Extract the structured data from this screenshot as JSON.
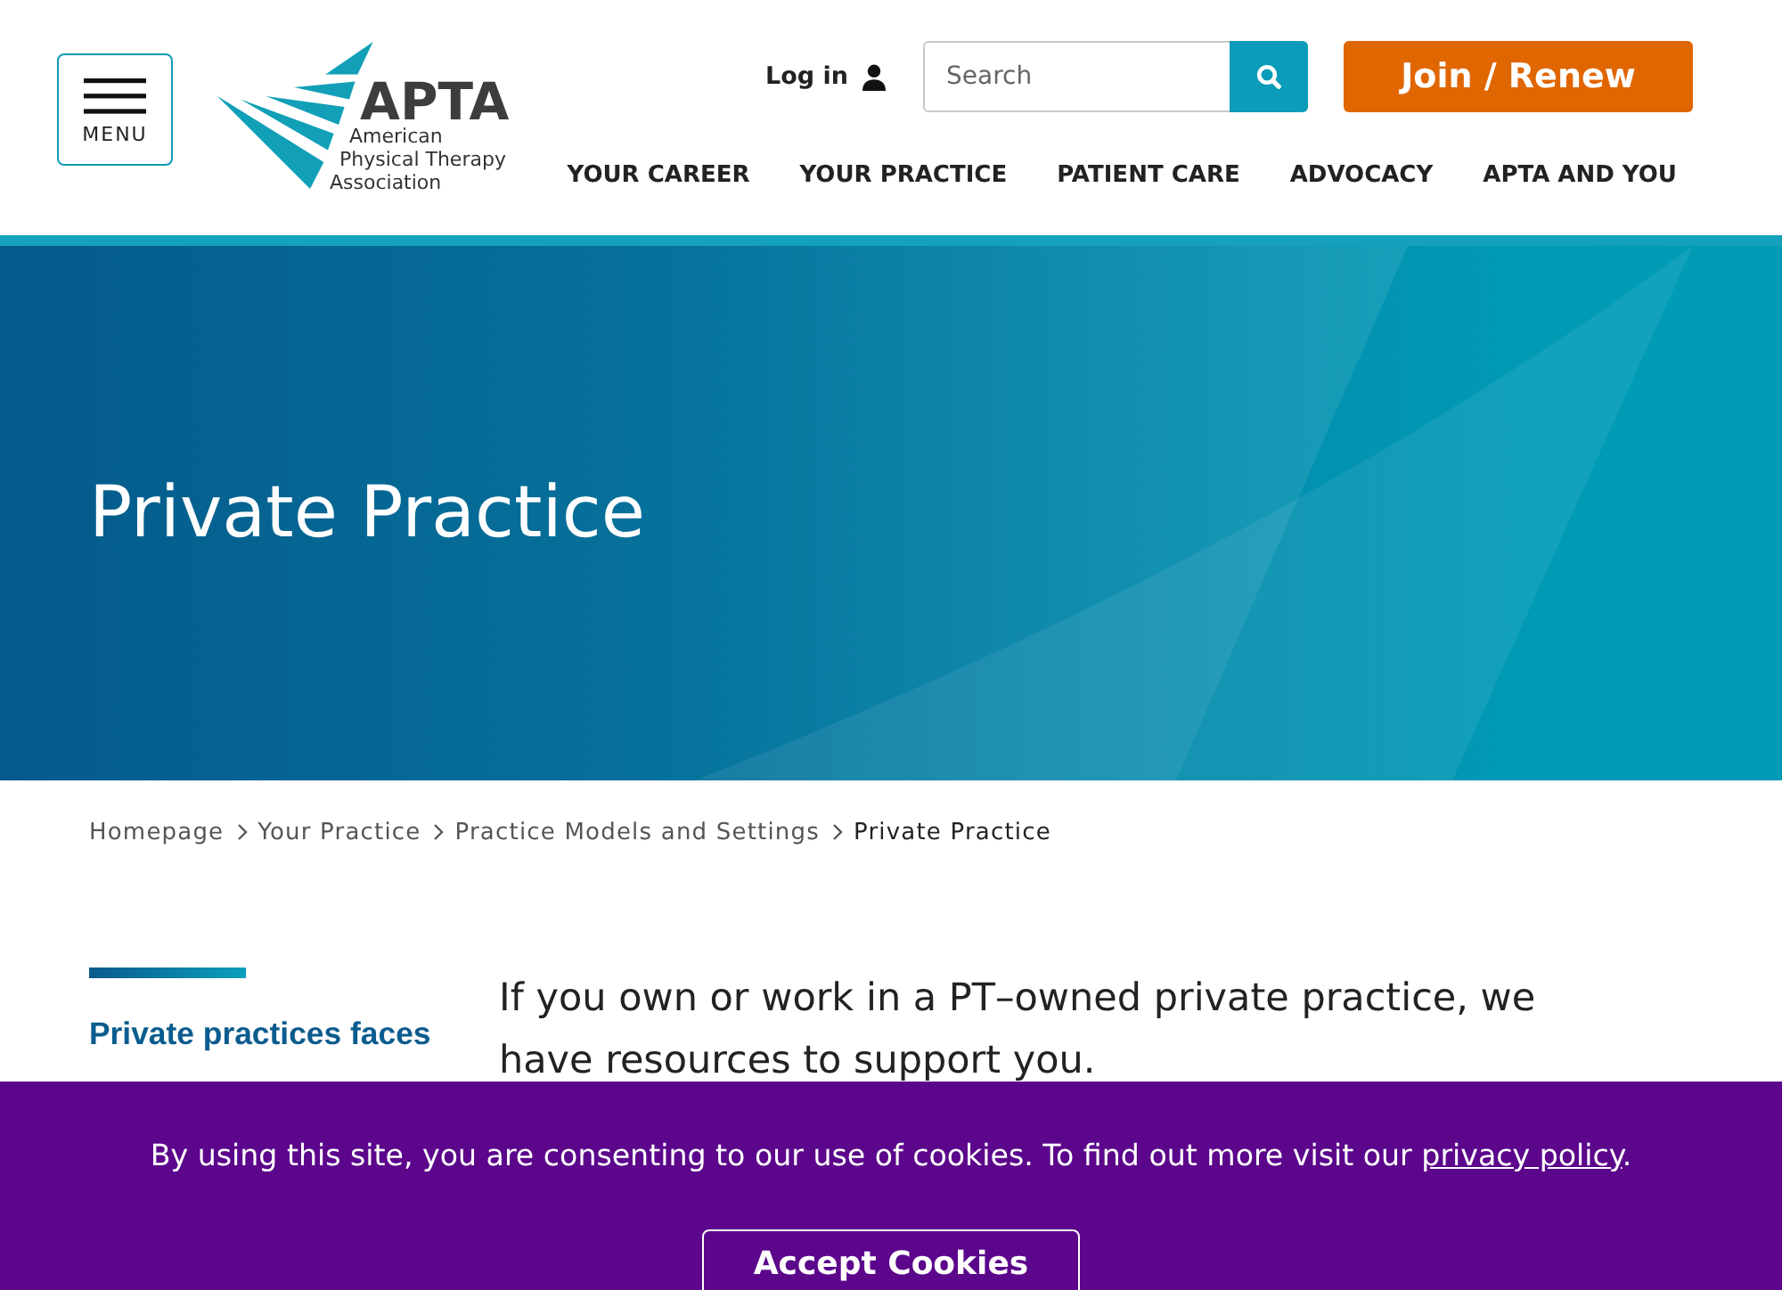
{
  "header": {
    "menu_button": {
      "label": "MENU"
    },
    "logo": {
      "wordmark": "APTA",
      "subtitle_lines": [
        "American",
        "Physical Therapy",
        "Association"
      ]
    },
    "login": {
      "label": "Log in"
    },
    "search": {
      "placeholder": "Search"
    },
    "join_button": {
      "label": "Join / Renew"
    },
    "nav": [
      "YOUR CAREER",
      "YOUR PRACTICE",
      "PATIENT CARE",
      "ADVOCACY",
      "APTA AND YOU"
    ]
  },
  "hero": {
    "title": "Private Practice"
  },
  "breadcrumb": [
    {
      "label": "Homepage",
      "current": false
    },
    {
      "label": "Your Practice",
      "current": false
    },
    {
      "label": "Practice Models and Settings",
      "current": false
    },
    {
      "label": "Private Practice",
      "current": true
    }
  ],
  "content": {
    "sidebar_heading": "Private practices faces",
    "intro": "If you own or work in a PT–owned private practice, we have resources to support you."
  },
  "cookie_banner": {
    "message": [
      {
        "kind": "text",
        "text": "By using this site, you are consenting to our use of cookies. To find out more visit our "
      },
      {
        "kind": "link",
        "text": "privacy policy"
      },
      {
        "kind": "text",
        "text": "."
      }
    ],
    "button": "Accept Cookies"
  }
}
